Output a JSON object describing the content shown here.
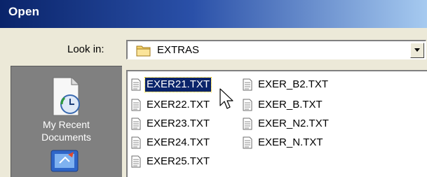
{
  "window": {
    "title": "Open"
  },
  "look_in": {
    "label": "Look in:",
    "value": "EXTRAS",
    "icon": "folder-icon"
  },
  "places": {
    "items": [
      {
        "label_line1": "My Recent",
        "label_line2": "Documents",
        "icon": "recent-documents-icon"
      },
      {
        "label": "",
        "icon": "desktop-icon"
      }
    ]
  },
  "files": [
    {
      "name": "EXER21.TXT",
      "selected": true
    },
    {
      "name": "EXER22.TXT"
    },
    {
      "name": "EXER23.TXT"
    },
    {
      "name": "EXER24.TXT"
    },
    {
      "name": "EXER25.TXT"
    },
    {
      "name": "EXER_B2.TXT"
    },
    {
      "name": "EXER_B.TXT"
    },
    {
      "name": "EXER_N2.TXT"
    },
    {
      "name": "EXER_N.TXT"
    }
  ],
  "colors": {
    "titlebar_start": "#0a246a",
    "titlebar_end": "#a6caf0",
    "dialog_bg": "#ece9d8",
    "places_bg": "#808080",
    "selection": "#0a246a"
  }
}
